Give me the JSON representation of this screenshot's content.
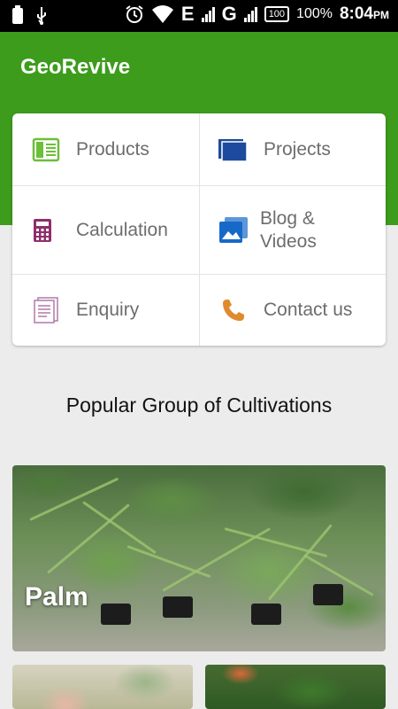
{
  "status_bar": {
    "network_1": "E",
    "network_2": "G",
    "battery_box": "100",
    "battery_percent": "100%",
    "time": "8:04",
    "ampm": "PM"
  },
  "app": {
    "title": "GeoRevive"
  },
  "menu": {
    "products": {
      "label": "Products",
      "icon": "products-icon"
    },
    "projects": {
      "label": "Projects",
      "icon": "projects-icon"
    },
    "calculation": {
      "label": "Calculation",
      "icon": "calculator-icon"
    },
    "blog_videos": {
      "label": "Blog &\nVideos",
      "icon": "image-gallery-icon"
    },
    "enquiry": {
      "label": "Enquiry",
      "icon": "document-icon"
    },
    "contact": {
      "label": "Contact us",
      "icon": "phone-icon"
    }
  },
  "colors": {
    "appbar": "#3d9c1c",
    "products_icon": "#6cbf3a",
    "projects_icon": "#1d4a9c",
    "calculation_icon": "#8e2f6c",
    "blog_icon": "#1769c9",
    "enquiry_icon": "#b07aa6",
    "contact_icon": "#e08a2e"
  },
  "section": {
    "title": "Popular Group of Cultivations"
  },
  "cultivations": [
    {
      "name": "Palm"
    }
  ]
}
